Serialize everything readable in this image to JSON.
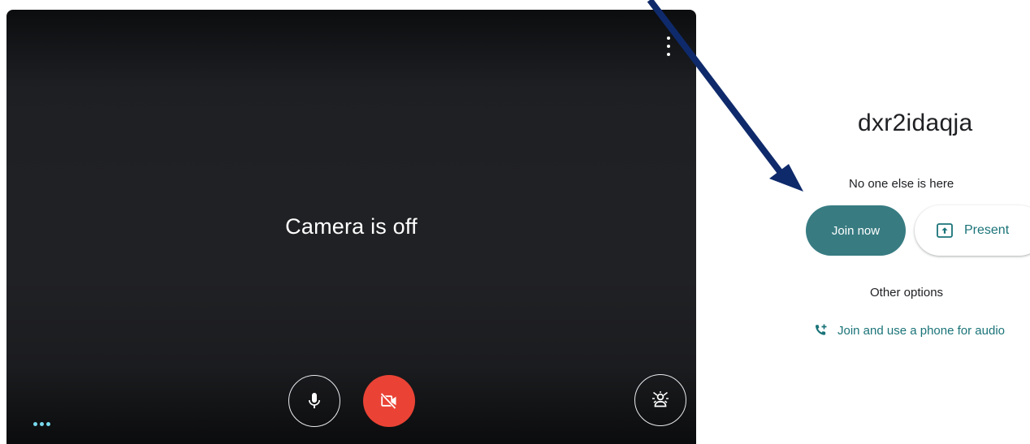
{
  "preview": {
    "camera_status": "Camera is off",
    "icons": {
      "more": "more-vert-icon",
      "mic": "microphone-icon",
      "camera": "video-off-icon",
      "effects": "visual-effects-icon",
      "overflow": "more-horiz-icon"
    },
    "camera_button_color": "#ea4335"
  },
  "join_panel": {
    "meeting_code": "dxr2idaqja",
    "status": "No one else is here",
    "join_label": "Join now",
    "present_label": "Present",
    "other_options_label": "Other options",
    "phone_audio_label": "Join and use a phone for audio",
    "accent_color": "#387c82",
    "link_color": "#1a7378"
  },
  "annotation": {
    "arrow_color": "#0f2a6b"
  }
}
